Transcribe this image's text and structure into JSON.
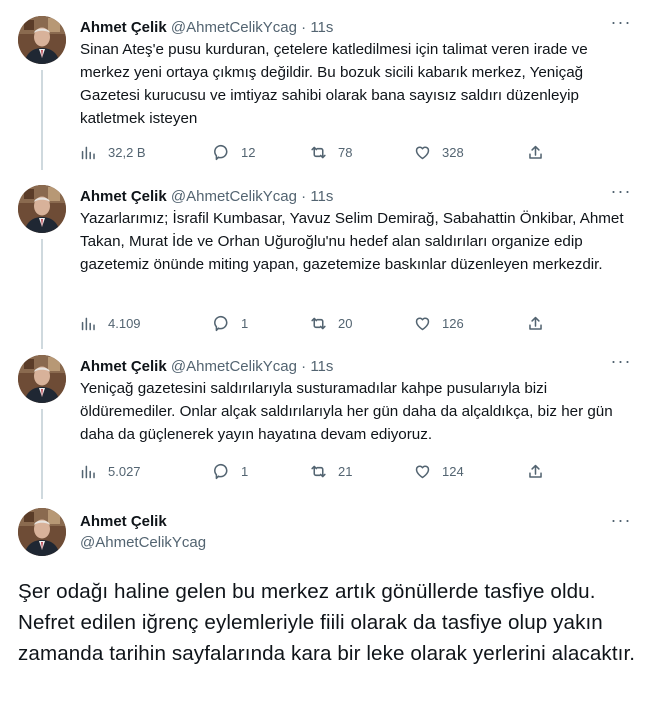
{
  "author": {
    "name": "Ahmet Çelik",
    "handle": "@AhmetCelikYcag"
  },
  "tweets": [
    {
      "time": "11s",
      "text": "Sinan Ateş'e pusu kurduran, çetelere katledilmesi için talimat veren irade ve merkez yeni ortaya çıkmış değildir. Bu bozuk sicili kabarık merkez, Yeniçağ Gazetesi kurucusu ve imtiyaz sahibi olarak bana sayısız saldırı düzenleyip katletmek isteyen",
      "views": "32,2 B",
      "replies": "12",
      "retweets": "78",
      "likes": "328"
    },
    {
      "time": "11s",
      "text": "Yazarlarımız; İsrafil Kumbasar, Yavuz Selim Demirağ, Sabahattin Önkibar, Ahmet Takan, Murat İde ve Orhan Uğuroğlu'nu hedef alan saldırıları organize edip gazetemiz önünde miting yapan, gazetemize baskınlar düzenleyen merkezdir.",
      "views": "4.109",
      "replies": "1",
      "retweets": "20",
      "likes": "126"
    },
    {
      "time": "11s",
      "text": "Yeniçağ gazetesini saldırılarıyla susturamadılar kahpe pusularıyla bizi öldüremediler. Onlar alçak saldırılarıyla her gün daha da alçaldıkça, biz her gün daha da güçlenerek yayın hayatına devam ediyoruz.",
      "views": "5.027",
      "replies": "1",
      "retweets": "21",
      "likes": "124"
    }
  ],
  "last_tweet": {
    "name": "Ahmet Çelik",
    "handle": "@AhmetCelikYcag",
    "text": "Şer odağı haline gelen bu merkez artık gönüllerde tasfiye oldu. Nefret edilen iğrenç eylemleriyle fiili olarak da tasfiye olup yakın zamanda tarihin sayfalarında kara bir leke olarak yerlerini alacaktır."
  },
  "separator": "·",
  "more_glyph": "···",
  "icons": {
    "views": "views-icon",
    "reply": "reply-icon",
    "retweet": "retweet-icon",
    "like": "like-icon",
    "share": "share-icon",
    "more": "more-icon"
  },
  "colors": {
    "text": "#0f1419",
    "secondary": "#536471",
    "thread_line": "#cfd9de"
  }
}
